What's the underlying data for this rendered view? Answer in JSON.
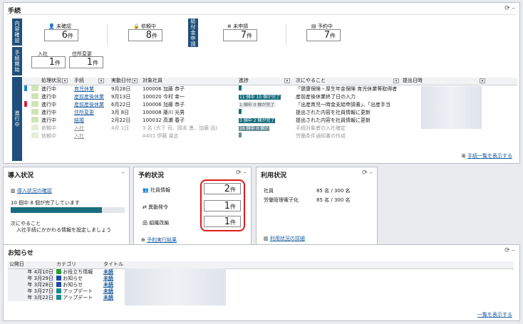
{
  "main": {
    "title": "手続",
    "labels": {
      "inner": "内容確認",
      "proc": "手続開始",
      "pay": "給付金申請",
      "ongoing": "進行中"
    },
    "counts": [
      {
        "label": "未確認",
        "value": "6",
        "unit": "件"
      },
      {
        "label": "依頼中",
        "value": "8",
        "unit": "件"
      },
      {
        "label": "未申請",
        "value": "7",
        "unit": "件"
      },
      {
        "label": "予約中",
        "value": "7",
        "unit": "件"
      },
      {
        "label": "入社",
        "value": "1",
        "unit": "件"
      },
      {
        "label": "住所変更",
        "value": "1",
        "unit": "件"
      }
    ],
    "headers": [
      "処理状況",
      "手続",
      "実動日付",
      "対象社員",
      "進捗",
      "次にやること",
      "提出日時"
    ],
    "rows": [
      {
        "status": "進行中",
        "proc": "育児休業",
        "date": "9月28日",
        "emp": "100006 加藤 恭子",
        "prog": "",
        "next": "「健康保険・厚生年金保険 育児休業等取得者"
      },
      {
        "status": "進行中",
        "proc": "産前産後休業",
        "date": "9月13日",
        "emp": "100020 今村 幸一",
        "prog": "11 個中 10 個が完了",
        "next": "産前産後休業終了日の入力"
      },
      {
        "status": "進行中",
        "proc": "産前産後休業",
        "date": "6月22日",
        "emp": "100006 加藤 恭子",
        "prog": "1 個中 0 個が完了",
        "next": "「出産育児一時金支給申請書」、「出産手当"
      },
      {
        "status": "進行中",
        "proc": "住所変更",
        "date": "3月 8日",
        "emp": "100008 藤川 光男",
        "prog": "",
        "next": "提出された内容を社員情報に更新"
      },
      {
        "status": "進行中",
        "proc": "結婚",
        "date": "2月22日",
        "emp": "100032 高瀬 春子",
        "prog": "3 個中 2 個が完了",
        "next": "提出された内容を社員情報に更新"
      },
      {
        "status": "依頼中",
        "proc": "入社",
        "date": "4月 1日",
        "emp": "3 名 (大下 司、岡本 勇、加藤 迅)",
        "prog": "16 個中 0 個が",
        "next": "手続対象者の入社確定"
      },
      {
        "status": "依頼中",
        "proc": "入社",
        "date": "",
        "emp": "A401 伊藤 貴志",
        "prog": "",
        "next": "労働条件通知書の作成"
      }
    ],
    "footer_link": "手続一覧を表示する"
  },
  "intro": {
    "title": "導入状況",
    "link": "導入状況の確認",
    "progress_text": "10 個中 8 個が完了しています",
    "progress": 0.8,
    "next1": "次にやること",
    "next2": "入社手続にかかわる情報を設定しましょう"
  },
  "reserve": {
    "title": "予約状況",
    "items": [
      {
        "label": "社員情報",
        "value": "2",
        "unit": "件"
      },
      {
        "label": "異動発令",
        "value": "1",
        "unit": "件"
      },
      {
        "label": "組織改編",
        "value": "1",
        "unit": "件"
      }
    ],
    "link": "予約実行結果"
  },
  "usage": {
    "title": "利用状況",
    "rows": [
      {
        "label": "社員",
        "value": "85 名 / 300 名"
      },
      {
        "label": "労働管理電子化",
        "value": "85 名 / 300 名"
      }
    ],
    "link": "利用状況の詳細"
  },
  "news": {
    "title": "お知らせ",
    "headers": [
      "公開日",
      "カテゴリ",
      "タイトル"
    ],
    "rows": [
      {
        "date": "年 4月10日",
        "cat": "お役立ち情報",
        "catcolor": "#2a9a3a",
        "title": "未読"
      },
      {
        "date": "年 3月29日",
        "cat": "お知らせ",
        "catcolor": "#1f4f9a",
        "title": "未読"
      },
      {
        "date": "年 3月28日",
        "cat": "お知らせ",
        "catcolor": "#1f4f9a",
        "title": "未読"
      },
      {
        "date": "年 3月27日",
        "cat": "アップデート",
        "catcolor": "#1a8a8a",
        "title": "未読"
      },
      {
        "date": "年 3月22日",
        "cat": "アップデート",
        "catcolor": "#1a8a8a",
        "title": "未読"
      }
    ],
    "link": "一覧を表示する"
  },
  "colors": {
    "accent": "#1f4f7a",
    "progress": "#196d7f",
    "highlight": "#e01a1a"
  }
}
